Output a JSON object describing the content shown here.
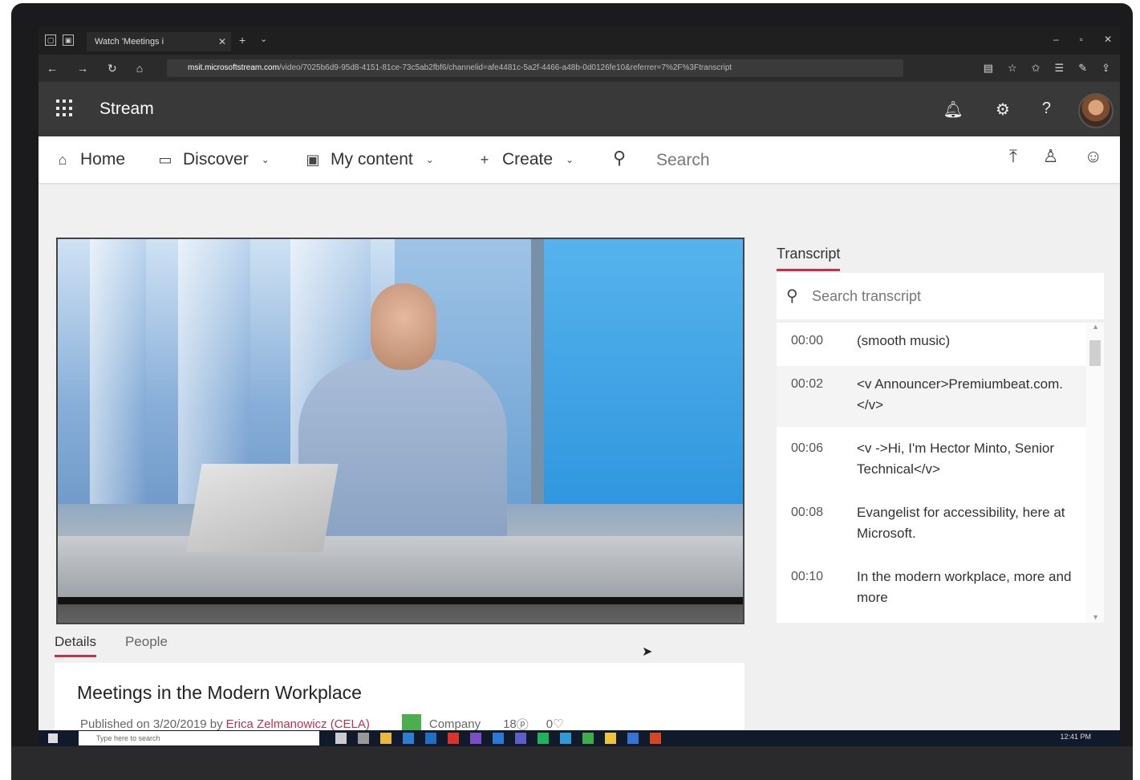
{
  "browser": {
    "tab_title": "Watch 'Meetings i",
    "url_host": "msit.microsoftstream.com",
    "url_rest": "/video/7025b6d9-95d8-4151-81ce-73c5ab2fbf6/channelid=afe4481c-5a2f-4466-a48b-0d0126fe10&referrer=7%2F%3Ftranscript"
  },
  "app": {
    "title": "Stream"
  },
  "header_icons": [
    "bell-icon",
    "gear-icon",
    "help-icon"
  ],
  "nav": {
    "home": "Home",
    "discover": "Discover",
    "my_content": "My content",
    "create": "Create",
    "search_placeholder": "Search"
  },
  "details": {
    "tabs": [
      "Details",
      "People"
    ],
    "video_title": "Meetings in the Modern Workplace",
    "published_prefix": "Published on 3/20/2019 by",
    "author": "Erica Zelmanowicz (CELA)",
    "audience": "Company",
    "views": "18",
    "likes": "0"
  },
  "transcript": {
    "heading": "Transcript",
    "search_placeholder": "Search transcript",
    "entries": [
      {
        "time": "00:00",
        "text": "(smooth music)"
      },
      {
        "time": "00:02",
        "text": "<v Announcer>Premiumbeat.com.</v>"
      },
      {
        "time": "00:06",
        "text": "<v ->Hi, I'm Hector Minto, Senior Technical</v>"
      },
      {
        "time": "00:08",
        "text": "Evangelist for accessibility, here at Microsoft."
      },
      {
        "time": "00:10",
        "text": "In the modern workplace, more and more"
      }
    ]
  },
  "taskbar": {
    "search_placeholder": "Type here to search",
    "clock": "12:41 PM"
  },
  "colors": {
    "accent": "#c4314b",
    "header_bg": "#393939",
    "company_badge": "#4cae4f"
  }
}
